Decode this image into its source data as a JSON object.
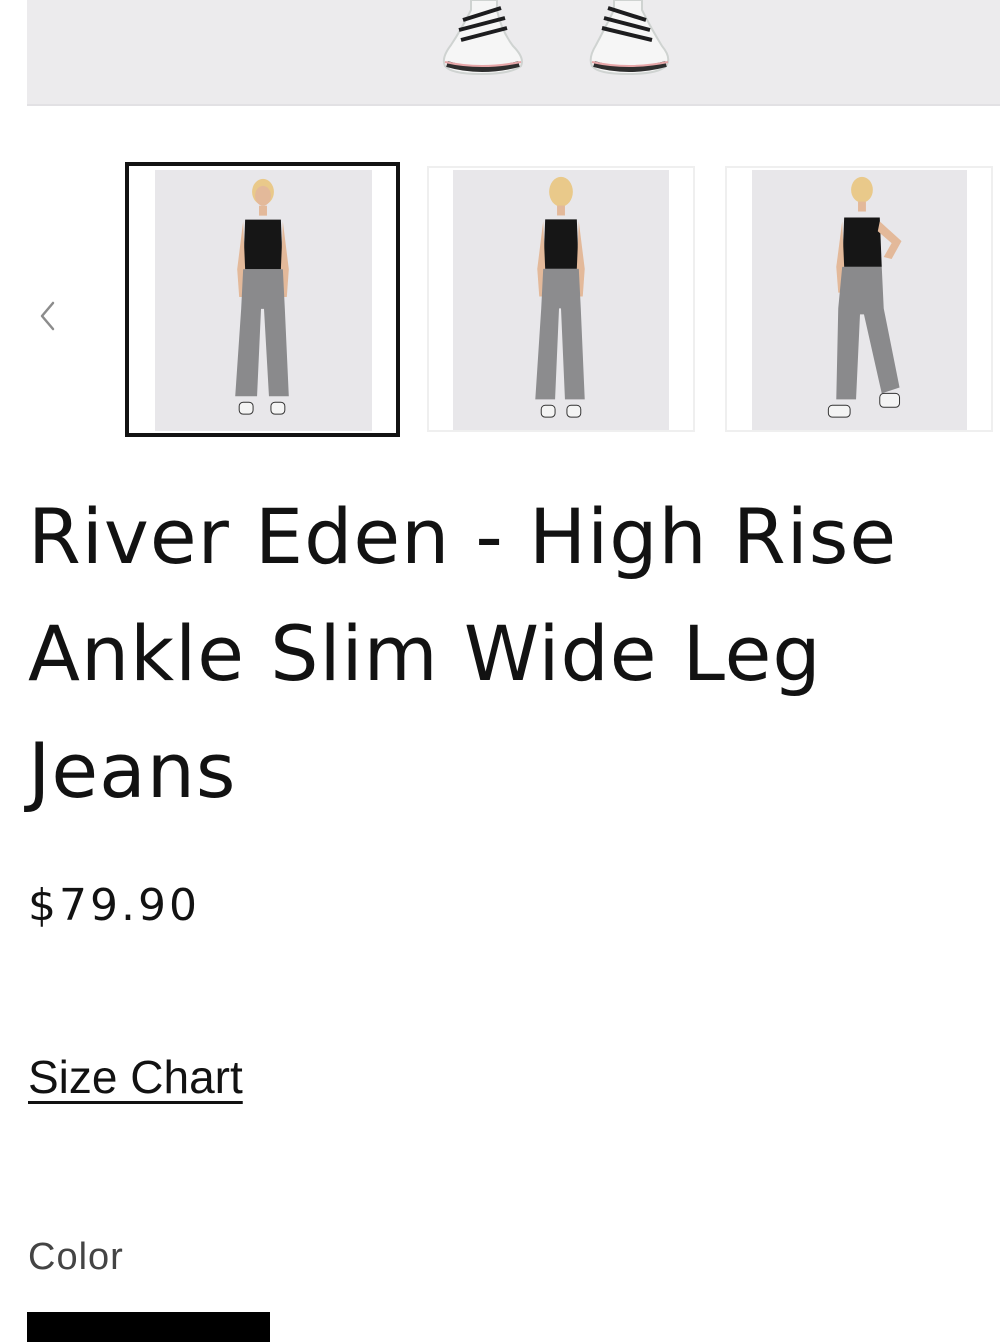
{
  "hero": {
    "image_alt": "Model wearing white sneakers"
  },
  "gallery": {
    "prev_icon": "chevron-left-icon",
    "thumbnails": [
      {
        "view": "front",
        "active": true
      },
      {
        "view": "back",
        "active": false
      },
      {
        "view": "side",
        "active": false
      }
    ]
  },
  "product": {
    "title_lines": [
      "River Eden - High Rise",
      "Ankle Slim Wide Leg",
      "Jeans"
    ],
    "price": "$79.90",
    "size_chart_label": "Size Chart",
    "color_label": "Color"
  },
  "colors": {
    "background": "#ffffff",
    "text": "#121212",
    "active_border": "#121212",
    "swatch_selected": "#000000",
    "denim_gray": "#8a8a8c",
    "top_black": "#161616"
  }
}
